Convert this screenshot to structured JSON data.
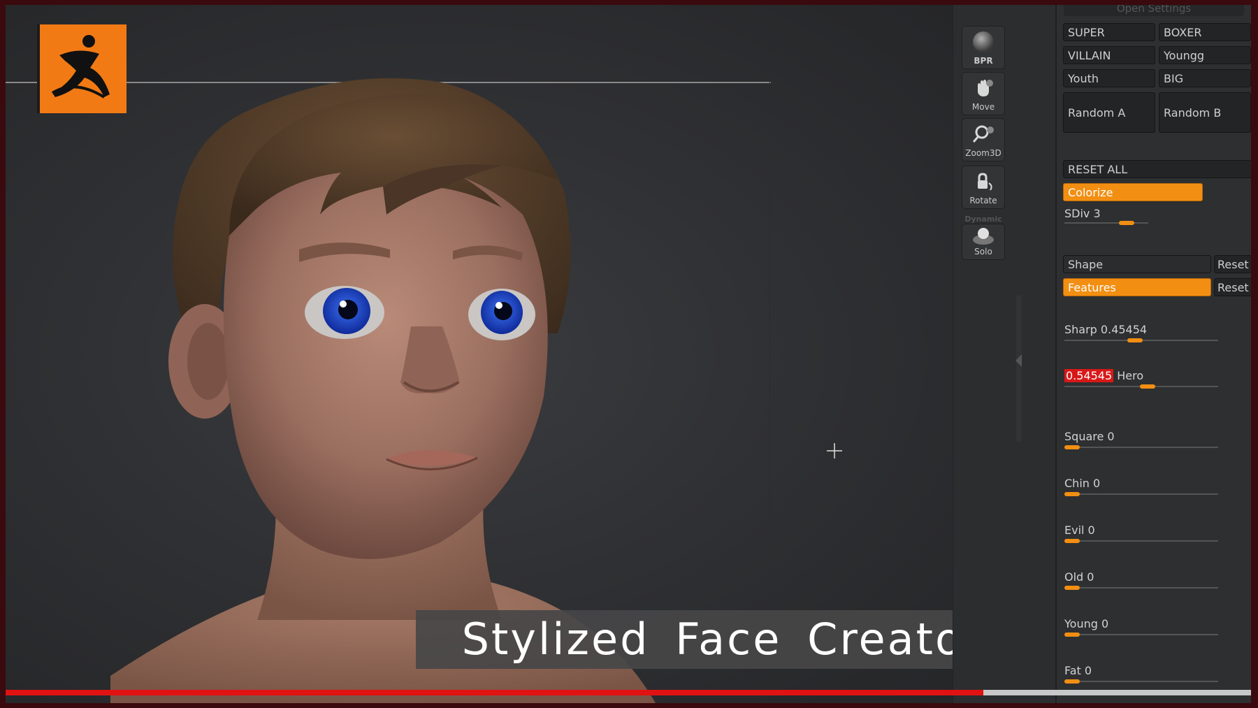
{
  "toolbar": {
    "bpr": "BPR",
    "move": "Move",
    "zoom3d": "Zoom3D",
    "rotate": "Rotate",
    "dynamic": "Dynamic",
    "solo": "Solo"
  },
  "panel": {
    "open_settings": "Open Settings",
    "presets": [
      "SUPER",
      "BOXER",
      "VILLAIN",
      "Youngg",
      "Youth",
      "BIG"
    ],
    "random_a": "Random A",
    "random_b": "Random B",
    "reset_all": "RESET ALL",
    "colorize": "Colorize",
    "sdiv": "SDiv 3",
    "shape": "Shape",
    "shape_reset": "Reset",
    "features": "Features",
    "features_reset": "Reset",
    "sharp": "Sharp 0.45454",
    "hero_value": "0.54545",
    "hero_label": " Hero",
    "square": "Square 0",
    "chin": "Chin 0",
    "evil": "Evil 0",
    "old": "Old 0",
    "young": "Young 0",
    "fat": "Fat 0"
  },
  "sliders": {
    "sdiv": 0.8,
    "sharp": 0.45454,
    "hero": 0.54545,
    "square": 0,
    "chin": 0,
    "evil": 0,
    "old": 0,
    "young": 0,
    "fat": 0
  },
  "banner": {
    "title": "Stylized Face Creator"
  },
  "video": {
    "progress": 0.785
  },
  "colors": {
    "accent": "#f28f12",
    "logo": "#f27a15",
    "progress": "#e01212"
  }
}
